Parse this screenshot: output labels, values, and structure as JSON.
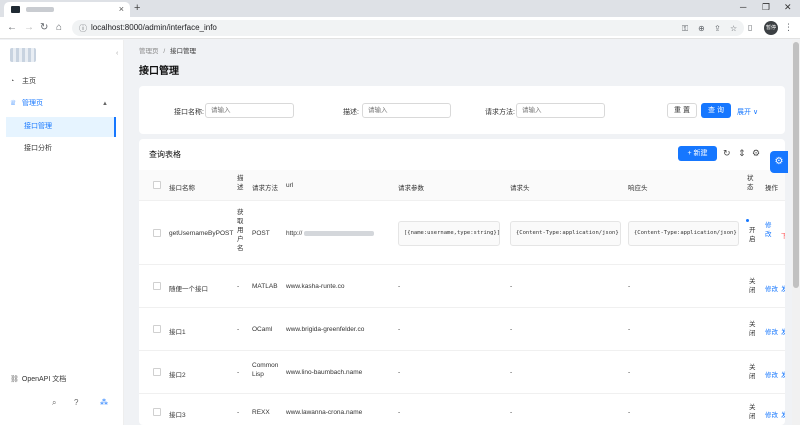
{
  "browser": {
    "new_tab": "+",
    "url": "localhost:8000/admin/interface_info",
    "profile": "暂停",
    "icons": [
      "back-icon",
      "forward-icon",
      "reload-icon",
      "home-icon",
      "key-icon",
      "zoom-icon",
      "share-icon",
      "star-icon",
      "extensions-icon",
      "sidepanel-icon",
      "menu-icon"
    ]
  },
  "sidebar": {
    "items": [
      {
        "label": "主页",
        "icon": "dashboard-icon"
      },
      {
        "label": "管理页",
        "icon": "crown-icon"
      }
    ],
    "sub_items": [
      {
        "label": "接口管理",
        "selected": true
      },
      {
        "label": "接口分析",
        "selected": false
      }
    ],
    "openapi": "OpenAPI 文档"
  },
  "breadcrumb": {
    "parent": "管理页",
    "sep": "/",
    "current": "接口管理"
  },
  "page_title": "接口管理",
  "search": {
    "fields": [
      {
        "label": "接口名称:",
        "placeholder": "请输入"
      },
      {
        "label": "描述:",
        "placeholder": "请输入"
      },
      {
        "label": "请求方法:",
        "placeholder": "请输入"
      }
    ],
    "reset": "重 置",
    "query": "查 询",
    "expand": "展开"
  },
  "table": {
    "title": "查询表格",
    "new_button": "新建",
    "columns": [
      "接口名称",
      "描述",
      "请求方法",
      "url",
      "请求参数",
      "请求头",
      "响应头",
      "状态",
      "操作"
    ],
    "rows": [
      {
        "name": "getUsernameByPOST",
        "desc": "获取用户名",
        "method": "POST",
        "url": "http://",
        "params": "[{name:username,type:string}]",
        "req_header": "{Content-Type:application/json}",
        "res_header": "{Content-Type:application/json}",
        "status": "开启",
        "edit": "修改",
        "op2": "下线"
      },
      {
        "name": "随便一个接口",
        "desc": "-",
        "method": "MATLAB",
        "url": "www.kasha-runte.co",
        "params": "-",
        "req_header": "-",
        "res_header": "-",
        "status": "关闭",
        "edit": "修改",
        "op2": "发布"
      },
      {
        "name": "接口1",
        "desc": "-",
        "method": "OCaml",
        "url": "www.brigida-greenfelder.co",
        "params": "-",
        "req_header": "-",
        "res_header": "-",
        "status": "关闭",
        "edit": "修改",
        "op2": "发布"
      },
      {
        "name": "接口2",
        "desc": "-",
        "method": "Common Lisp",
        "url": "www.lino-baumbach.name",
        "params": "-",
        "req_header": "-",
        "res_header": "-",
        "status": "关闭",
        "edit": "修改",
        "op2": "发布"
      },
      {
        "name": "接口3",
        "desc": "-",
        "method": "REXX",
        "url": "www.lawanna-crona.name",
        "params": "-",
        "req_header": "-",
        "res_header": "-",
        "status": "关闭",
        "edit": "修改",
        "op2": "发布"
      }
    ]
  },
  "colors": {
    "primary": "#1677ff",
    "danger": "#ff4d4f",
    "bg": "#f0f2f5"
  }
}
